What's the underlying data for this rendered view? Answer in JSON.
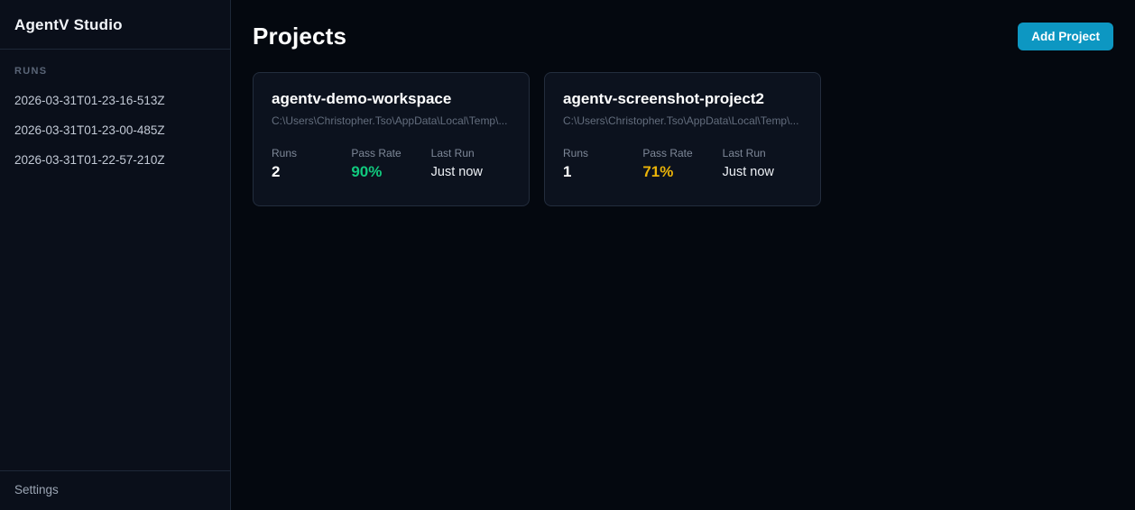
{
  "app": {
    "title": "AgentV Studio"
  },
  "sidebar": {
    "runs_header": "RUNS",
    "runs": [
      "2026-03-31T01-23-16-513Z",
      "2026-03-31T01-23-00-485Z",
      "2026-03-31T01-22-57-210Z"
    ],
    "settings_label": "Settings"
  },
  "main": {
    "title": "Projects",
    "add_button_label": "Add Project"
  },
  "projects": [
    {
      "name": "agentv-demo-workspace",
      "path": "C:\\Users\\Christopher.Tso\\AppData\\Local\\Temp\\...",
      "stats": [
        {
          "label": "Runs",
          "value": "2",
          "color": "#ffffff"
        },
        {
          "label": "Pass Rate",
          "value": "90%",
          "color": "#11c97e"
        },
        {
          "label": "Last Run",
          "value": "Just now",
          "color": "#eef1f6"
        }
      ]
    },
    {
      "name": "agentv-screenshot-project2",
      "path": "C:\\Users\\Christopher.Tso\\AppData\\Local\\Temp\\...",
      "stats": [
        {
          "label": "Runs",
          "value": "1",
          "color": "#ffffff"
        },
        {
          "label": "Pass Rate",
          "value": "71%",
          "color": "#eab308"
        },
        {
          "label": "Last Run",
          "value": "Just now",
          "color": "#eef1f6"
        }
      ]
    }
  ],
  "colors": {
    "accent": "#0d97c2",
    "pass_green": "#11c97e",
    "pass_yellow": "#eab308",
    "page_bg": "#04080f",
    "sidebar_bg": "#0a0f1a",
    "card_bg": "#0c121e"
  }
}
